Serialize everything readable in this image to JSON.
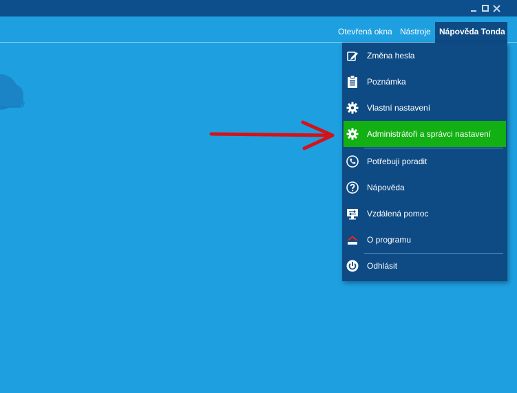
{
  "nav": {
    "open_windows": "Otevřená okna",
    "tools": "Nástroje",
    "help_user": "Nápověda Tonda"
  },
  "menu": {
    "items": [
      {
        "label": "Změna hesla",
        "icon": "password-change-icon"
      },
      {
        "label": "Poznámka",
        "icon": "clipboard-icon"
      },
      {
        "label": "Vlastní nastavení",
        "icon": "gear-icon"
      },
      {
        "label": "Administrátoři a správci nastavení",
        "icon": "gear-icon",
        "highlighted": true
      },
      {
        "label": "Potřebuji poradit",
        "icon": "phone-icon"
      },
      {
        "label": "Nápověda",
        "icon": "question-icon"
      },
      {
        "label": "Vzdálená pomoc",
        "icon": "remote-help-icon"
      },
      {
        "label": "O programu",
        "icon": "app-logo-icon"
      },
      {
        "label": "Odhlásit",
        "icon": "power-icon"
      }
    ]
  },
  "colors": {
    "background": "#1e9fe0",
    "titlebar": "#0d4e8c",
    "menu": "#0e4a84",
    "highlight": "#12b013",
    "arrow": "#d3131a"
  }
}
